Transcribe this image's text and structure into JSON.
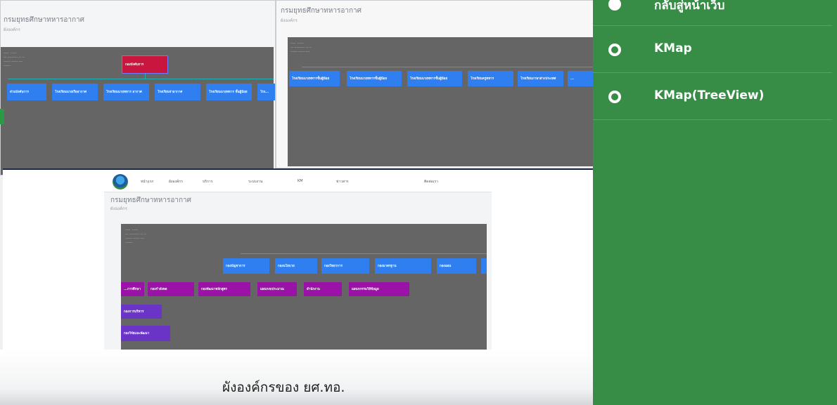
{
  "top_left_screen": {
    "title": "กรมยุทธศึกษาทหารอากาศ",
    "subtitle": "ผังองค์กร",
    "root_node": "กองบังคับการ",
    "level1": [
      "ส่วนบังคับการ",
      "โรงเรียนนายเรืออากาศ",
      "โรงเรียนนายทหาร อากาศ",
      "โรงเรียนจ่าอากาศ",
      "โรงเรียนนายทหาร ชั้นผู้น้อย",
      "โรง..."
    ]
  },
  "top_right_screen": {
    "title": "กรมยุทธศึกษาทหารอากาศ",
    "subtitle": "ผังองค์กร",
    "level1": [
      "โรงเรียนนายทหารชั้นผู้น้อย",
      "โรงเรียนนายทหารชั้นผู้น้อย",
      "โรงเรียนนายทหารชั้นผู้น้อย",
      "โรงเรียนครูทหาร",
      "โรงเรียนภาษาต่างประเทศ",
      "..."
    ]
  },
  "bottom_screen": {
    "title": "กรมยุทธศึกษาทหารอากาศ",
    "subtitle": "ผังองค์กร",
    "nav_items": [
      "หน้าแรก",
      "ผังองค์กร",
      "บริการ",
      "ระบบงาน",
      "KM",
      "ข่าวสาร",
      "ติดต่อเรา"
    ],
    "blue_row": [
      "กองบัญชาการ",
      "กองนโยบาย",
      "กองวิทยาการ",
      "กองมาตรฐาน",
      "กองแผน"
    ],
    "magenta_row": [
      "...การศึกษา",
      "กองกำลังพล",
      "กองพัฒนาหลักสูตร",
      "แผนกงบประมาณ",
      "สำนักงาน",
      "แผนกกรรมวิธีข้อมูล"
    ],
    "purple_nodes": [
      "กองการบริหาร",
      "กองวิจัยและพัฒนา"
    ]
  },
  "caption": "ผังองค์กรของ ยศ.ทอ.",
  "menu": {
    "items": [
      {
        "label": "กลับสู่หน้าเว็บ"
      },
      {
        "label": "KMap"
      },
      {
        "label": "KMap(TreeView)"
      }
    ]
  },
  "colors": {
    "menu_panel": "#378c46",
    "node_blue": "#2f7ff0",
    "node_magenta": "#9a12a6",
    "node_purple": "#6a34c7",
    "node_red": "#c9163f",
    "canvas": "#656565"
  }
}
